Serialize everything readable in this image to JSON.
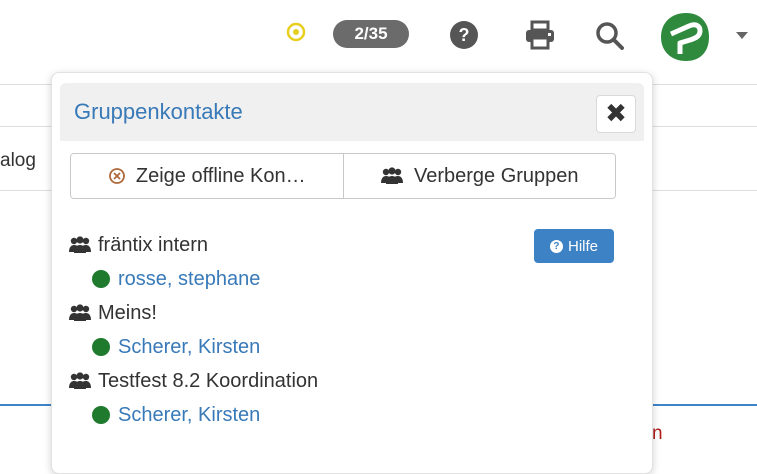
{
  "toolbar": {
    "counter_badge": "2/35",
    "icons": [
      "status-ring-icon",
      "help-icon",
      "print-icon",
      "search-icon",
      "app-logo-icon",
      "caret-down-icon"
    ],
    "colors": {
      "status_ring": "#e6cf1f",
      "badge_bg": "#6b6b6b",
      "logo": "#2f8a3e"
    }
  },
  "background": {
    "fragment_text": "alog",
    "fragment_red": "n"
  },
  "popover": {
    "title": "Gruppenkontakte",
    "close_label": "✖",
    "buttons": {
      "show_offline": "Zeige offline Kon…",
      "hide_groups": "Verberge Gruppen"
    },
    "help_label": "Hilfe",
    "groups": [
      {
        "name": "fräntix intern",
        "members": [
          {
            "name": "rosse, stephane"
          }
        ]
      },
      {
        "name": "Meins!",
        "members": [
          {
            "name": "Scherer, Kirsten"
          }
        ]
      },
      {
        "name": "Testfest 8.2 Koordination",
        "members": [
          {
            "name": "Scherer, Kirsten"
          }
        ]
      }
    ],
    "colors": {
      "title": "#3879b8",
      "online_dot": "#1f7a2e",
      "help_bg": "#3c82c4"
    }
  }
}
